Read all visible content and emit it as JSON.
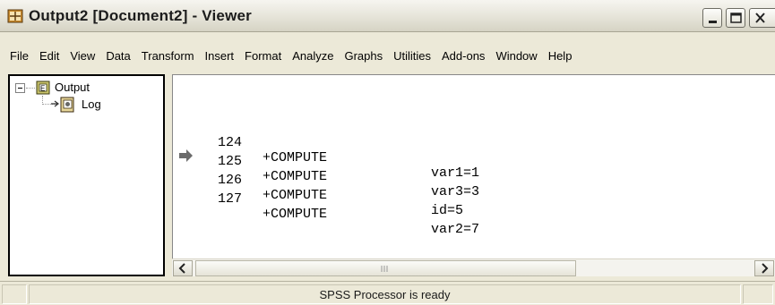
{
  "window": {
    "title": "Output2 [Document2] - Viewer",
    "icon": "spss-viewer-icon"
  },
  "controls": {
    "minimize_icon": "minimize-icon",
    "maximize_icon": "maximize-icon",
    "close_icon": "close-icon"
  },
  "menu": {
    "items": [
      "File",
      "Edit",
      "View",
      "Data",
      "Transform",
      "Insert",
      "Format",
      "Analyze",
      "Graphs",
      "Utilities",
      "Add-ons",
      "Window",
      "Help"
    ]
  },
  "outline": {
    "root": {
      "label": "Output",
      "icon": "output-book-icon",
      "expander_icon": "collapse-minus-icon"
    },
    "child": {
      "label": "Log",
      "icon": "log-icon"
    }
  },
  "log": {
    "lines": [
      {
        "num": "124",
        "cmd": "+COMPUTE",
        "assign": "var1=1"
      },
      {
        "num": "125",
        "cmd": "+COMPUTE",
        "assign": "var3=3"
      },
      {
        "num": "126",
        "cmd": "+COMPUTE",
        "assign": "id=5"
      },
      {
        "num": "127",
        "cmd": "+COMPUTE",
        "assign": "var2=7"
      }
    ],
    "current_marker_icon": "current-item-arrow-icon"
  },
  "scrollbar": {
    "left_icon": "scroll-left-icon",
    "right_icon": "scroll-right-icon",
    "grip_icon": "scroll-grip-icon"
  },
  "status": {
    "text": "SPSS Processor is ready"
  },
  "colors": {
    "window_face": "#ece9d8",
    "pane_border": "#000000"
  }
}
